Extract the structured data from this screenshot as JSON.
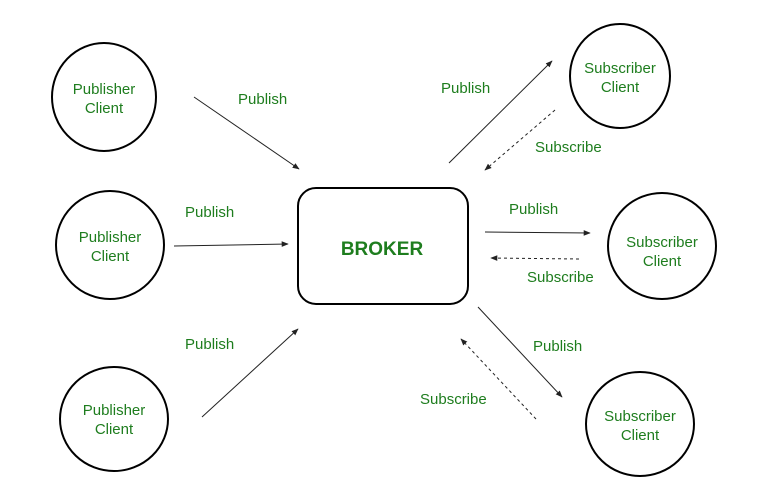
{
  "colors": {
    "text": "#1e7d1e",
    "stroke": "#000000",
    "edge": "#222222",
    "background": "#ffffff"
  },
  "broker": {
    "label": "BROKER"
  },
  "publishers": [
    {
      "line1": "Publisher",
      "line2": "Client"
    },
    {
      "line1": "Publisher",
      "line2": "Client"
    },
    {
      "line1": "Publisher",
      "line2": "Client"
    }
  ],
  "subscribers": [
    {
      "line1": "Subscriber",
      "line2": "Client"
    },
    {
      "line1": "Subscriber",
      "line2": "Client"
    },
    {
      "line1": "Subscriber",
      "line2": "Client"
    }
  ],
  "edges": {
    "pub1_to_broker": "Publish",
    "pub2_to_broker": "Publish",
    "pub3_to_broker": "Publish",
    "broker_to_sub1": "Publish",
    "sub1_to_broker": "Subscribe",
    "broker_to_sub2": "Publish",
    "sub2_to_broker": "Subscribe",
    "broker_to_sub3": "Publish",
    "sub3_to_broker": "Subscribe"
  }
}
